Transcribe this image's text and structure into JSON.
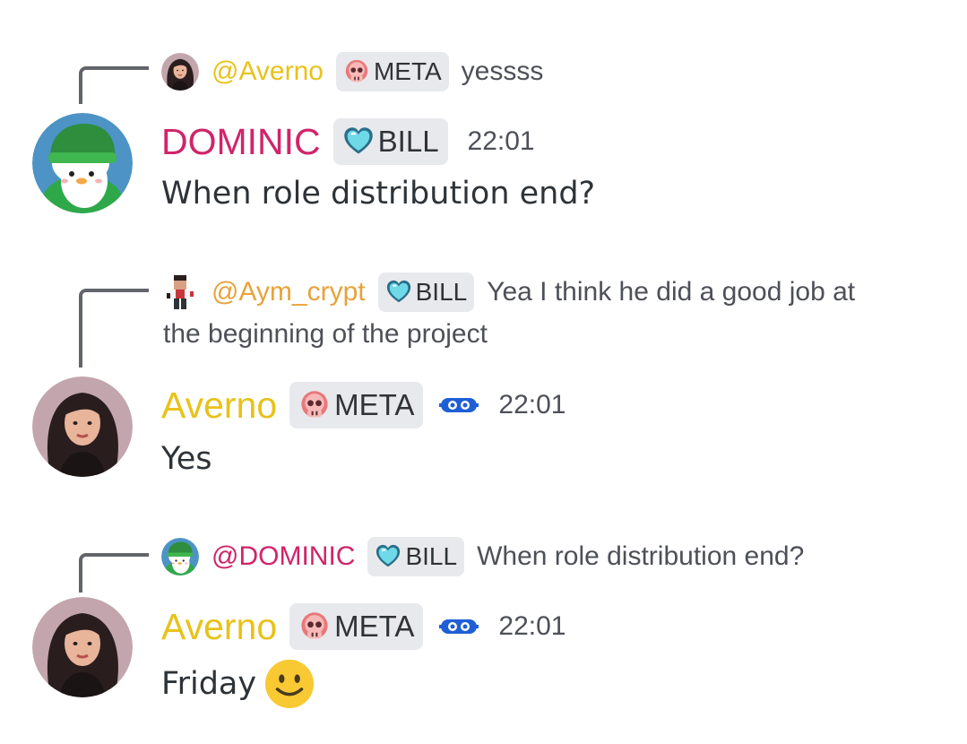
{
  "colors": {
    "dominic": "#d1246a",
    "averno": "#e8c21a",
    "aym": "#e8a23a",
    "connector": "#62656b",
    "badge_bg": "#e8e9ec"
  },
  "messages": [
    {
      "reply": {
        "name": "@Averno",
        "badge_icon": "skull-icon",
        "badge_label": "META",
        "text": "yessss"
      },
      "author": "DOMINIC",
      "author_badge_icon": "heart-icon",
      "author_badge_label": "BILL",
      "timestamp": "22:01",
      "content": "When role distribution end?"
    },
    {
      "reply": {
        "name": "@Aym_crypt",
        "badge_icon": "heart-icon",
        "badge_label": "BILL",
        "text": "Yea I think he did a good job at",
        "text_cont": "the beginning of the project"
      },
      "author": "Averno",
      "author_badge_icon": "skull-icon",
      "author_badge_label": "META",
      "extra_icon": "glasses-icon",
      "timestamp": "22:01",
      "content": "Yes"
    },
    {
      "reply": {
        "name": "@DOMINIC",
        "badge_icon": "heart-icon",
        "badge_label": "BILL",
        "text": "When role distribution end?"
      },
      "author": "Averno",
      "author_badge_icon": "skull-icon",
      "author_badge_label": "META",
      "extra_icon": "glasses-icon",
      "timestamp": "22:01",
      "content": "Friday",
      "content_emoji": "smiley-emoji-icon"
    }
  ]
}
